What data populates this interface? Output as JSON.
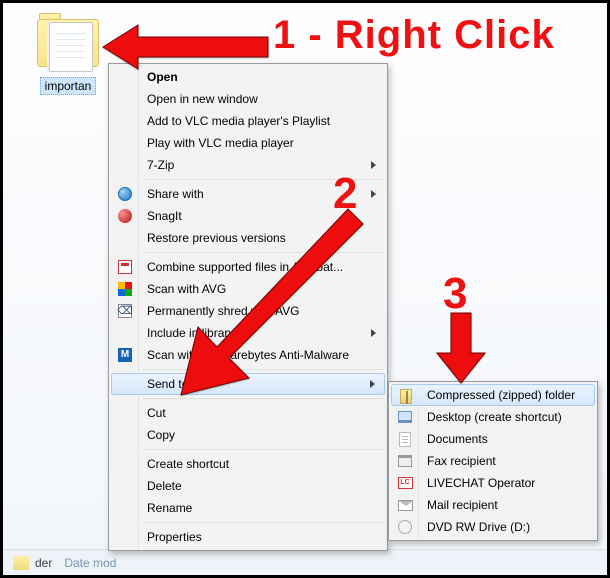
{
  "folder": {
    "label": "importan"
  },
  "callouts": {
    "c1": "1 - Right Click",
    "c2": "2",
    "c3": "3"
  },
  "menu1": {
    "open": "Open",
    "open_new": "Open in new window",
    "vlc_add": "Add to VLC media player's Playlist",
    "vlc_play": "Play with VLC media player",
    "sevenzip": "7-Zip",
    "share": "Share with",
    "snagit": "SnagIt",
    "restore": "Restore previous versions",
    "acrobat": "Combine supported files in Acrobat...",
    "avg": "Scan with AVG",
    "shred": "Permanently shred with AVG",
    "library": "Include in library",
    "malwarebytes": "Scan with Malwarebytes Anti-Malware",
    "sendto": "Send to",
    "cut": "Cut",
    "copy": "Copy",
    "shortcut": "Create shortcut",
    "delete": "Delete",
    "rename": "Rename",
    "properties": "Properties"
  },
  "menu2": {
    "zip": "Compressed (zipped) folder",
    "desktop": "Desktop (create shortcut)",
    "documents": "Documents",
    "fax": "Fax recipient",
    "livechat": "LIVECHAT Operator",
    "mail": "Mail recipient",
    "dvd": "DVD RW Drive (D:)"
  },
  "status": {
    "der": "der",
    "datemod": "Date mod"
  }
}
